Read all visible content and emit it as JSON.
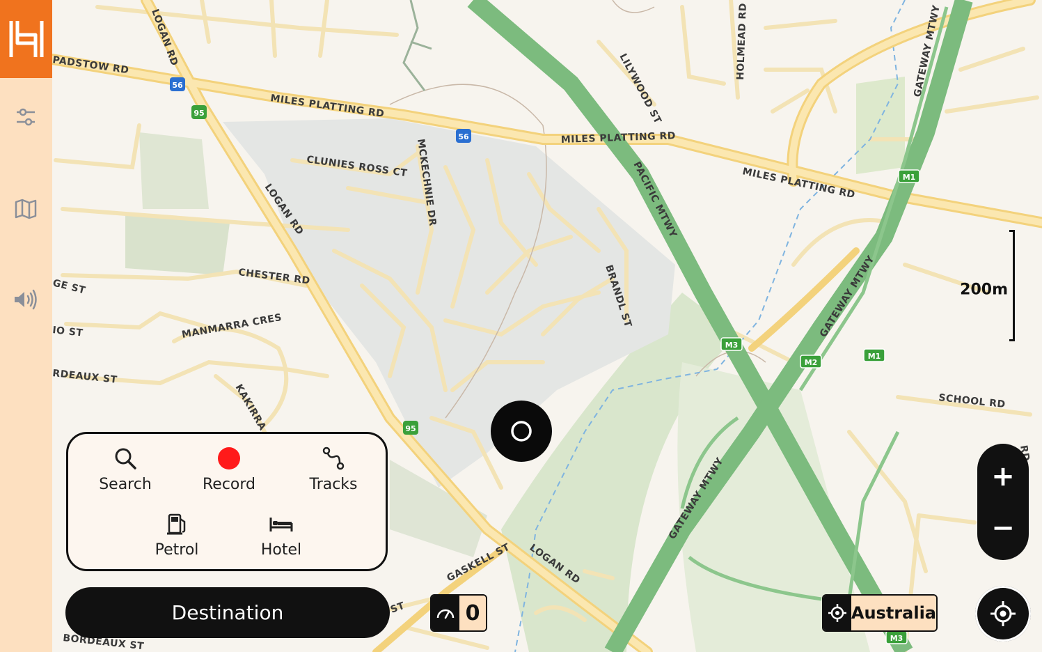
{
  "app": {
    "colors": {
      "brand": "#f0731e",
      "sidebar": "#fde0c0",
      "accent_dark": "#111111",
      "record_dot": "#ff1a1a",
      "motorway": "#7cbb7e",
      "major_road": "#f6d98c"
    }
  },
  "sidebar": {
    "logo_icon": "h-logo-icon",
    "items": [
      {
        "icon": "sliders-icon"
      },
      {
        "icon": "map-icon"
      },
      {
        "icon": "speaker-icon"
      }
    ]
  },
  "map": {
    "road_labels": {
      "padstow": "PADSTOW RD",
      "logan_top": "LOGAN RD",
      "miles_platting_1": "MILES PLATTING RD",
      "miles_platting_2": "MILES PLATTING RD",
      "miles_platting_3": "MILES PLATTING RD",
      "lilywood": "LILYWOOD ST",
      "holmead": "HOLMEAD RD",
      "gateway_top": "GATEWAY MTWY",
      "clunies": "CLUNIES ROSS CT",
      "mckechnie": "MCKECHNIE DR",
      "logan_mid": "LOGAN RD",
      "pacific": "PACIFIC MTWY",
      "chester": "CHESTER RD",
      "ge_st": "GE ST",
      "brandl": "BRANDL ST",
      "gateway_mid": "GATEWAY MTWY",
      "manmarra": "MANMARRA CRES",
      "io_st": "IO ST",
      "bordeaux_1": "RDEAUX ST",
      "kakirra": "KAKIRRA",
      "school": "SCHOOL RD",
      "gateway_low": "GATEWAY MTWY",
      "gaskell": "GASKELL ST",
      "logan_low": "LOGAN RD",
      "st_low": "ST",
      "bordeaux_2": "BORDEAUX ST",
      "rd_right": "RD"
    },
    "shields": {
      "s56a": "56",
      "s95a": "95",
      "s56b": "56",
      "m1a": "M1",
      "m3": "M3",
      "m2": "M2",
      "m1b": "M1",
      "s95b": "95",
      "m3b": "M3"
    },
    "scale_label": "200m"
  },
  "quick_actions": {
    "search": {
      "label": "Search",
      "icon": "search-icon"
    },
    "record": {
      "label": "Record",
      "icon": "record-dot-icon"
    },
    "tracks": {
      "label": "Tracks",
      "icon": "route-icon"
    },
    "petrol": {
      "label": "Petrol",
      "icon": "fuel-pump-icon"
    },
    "hotel": {
      "label": "Hotel",
      "icon": "bed-icon"
    }
  },
  "destination_label": "Destination",
  "speed": {
    "value": "0",
    "icon": "speedometer-icon"
  },
  "region": {
    "label": "Australia",
    "icon": "gps-crosshair-icon"
  },
  "zoom": {
    "in_label": "+",
    "out_label": "−"
  }
}
